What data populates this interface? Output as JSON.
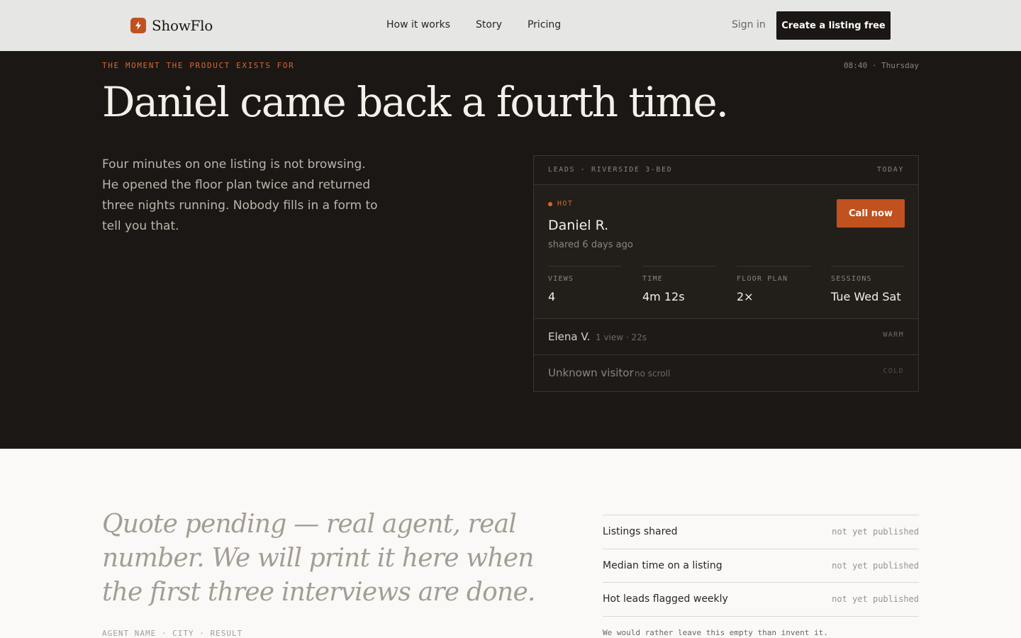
{
  "header": {
    "brand": "ShowFlo",
    "nav": [
      "How it works",
      "Story",
      "Pricing"
    ],
    "sign_in": "Sign in",
    "cta": "Create a listing free"
  },
  "hero": {
    "eyebrow": "THE MOMENT THE PRODUCT EXISTS FOR",
    "clock": "08:40 · Thursday",
    "headline": "Daniel came back a fourth time.",
    "lede": "Four minutes on one listing is not browsing. He opened the floor plan twice and returned three nights running. Nobody fills in a form to tell you that."
  },
  "card": {
    "title": "LEADS · RIVERSIDE 3-BED",
    "period": "TODAY",
    "hot": {
      "tag": "HOT",
      "name": "Daniel R.",
      "sub": "shared 6 days ago",
      "action": "Call now",
      "stats": [
        {
          "label": "VIEWS",
          "value": "4"
        },
        {
          "label": "TIME",
          "value": "4m 12s"
        },
        {
          "label": "FLOOR PLAN",
          "value": "2×"
        },
        {
          "label": "SESSIONS",
          "value": "Tue Wed Sat"
        }
      ]
    },
    "rows": [
      {
        "name": "Elena V.",
        "meta": "1 view · 22s",
        "tag": "WARM"
      },
      {
        "name": "Unknown visitor",
        "meta": "no scroll",
        "tag": "COLD"
      }
    ]
  },
  "proof": {
    "quote": "Quote pending — real agent, real number. We will print it here when the first three interviews are done.",
    "attribution": "AGENT NAME · CITY · RESULT",
    "metrics": [
      {
        "label": "Listings shared",
        "value": "not yet published"
      },
      {
        "label": "Median time on a listing",
        "value": "not yet published"
      },
      {
        "label": "Hot leads flagged weekly",
        "value": "not yet published"
      }
    ],
    "disclaimer": "We would rather leave this empty than invent it."
  },
  "colors": {
    "accent": "#c1511f",
    "dark": "#1a1714",
    "light": "#faf9f7"
  }
}
